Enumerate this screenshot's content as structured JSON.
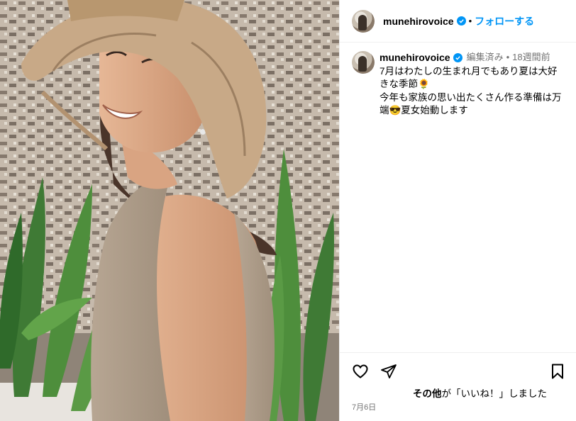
{
  "header": {
    "username": "munehirovoice",
    "separator": "•",
    "follow_label": "フォローする"
  },
  "caption": {
    "username": "munehirovoice",
    "edited": "編集済み",
    "separator": "•",
    "time_ago": "18週間前",
    "text": "7月はわたしの生まれ月でもあり夏は大好きな季節🌻\n今年も家族の思い出たくさん作る準備は万端😎夏女始動します"
  },
  "footer": {
    "likes_bold": "その他",
    "likes_rest": "が「いいね！」しました",
    "date": "7月6日"
  },
  "icons": {
    "verified": "verified-badge-icon",
    "like": "heart-icon",
    "share": "paper-plane-icon",
    "save": "bookmark-icon"
  },
  "colors": {
    "link": "#0095f6",
    "verified": "#0095f6",
    "meta": "#737373",
    "divider": "#efefef"
  }
}
